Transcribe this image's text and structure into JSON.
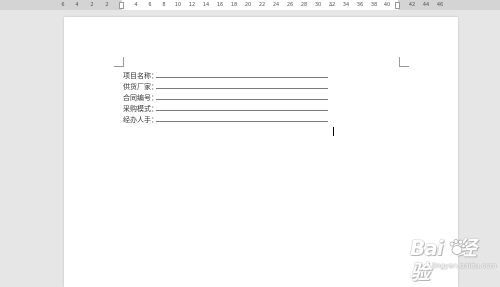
{
  "ruler": {
    "ticks": [
      "6",
      "4",
      "2",
      "2",
      "4",
      "6",
      "8",
      "10",
      "12",
      "14",
      "16",
      "18",
      "20",
      "22",
      "24",
      "26",
      "28",
      "30",
      "32",
      "34",
      "36",
      "38",
      "40",
      "42",
      "44",
      "46"
    ]
  },
  "form": {
    "rows": [
      {
        "label": "项目名称："
      },
      {
        "label": "供货厂家："
      },
      {
        "label": "合同编号："
      },
      {
        "label": "采购模式："
      },
      {
        "label": "经办人手："
      }
    ]
  },
  "watermark": {
    "logo_text": "Bai",
    "logo_suffix": "经验",
    "url": "jingyan.baidu.com",
    "color": "#ffffff"
  },
  "colors": {
    "background": "#e6e6e6",
    "page": "#ffffff",
    "ruler": "#d4d4d4"
  }
}
